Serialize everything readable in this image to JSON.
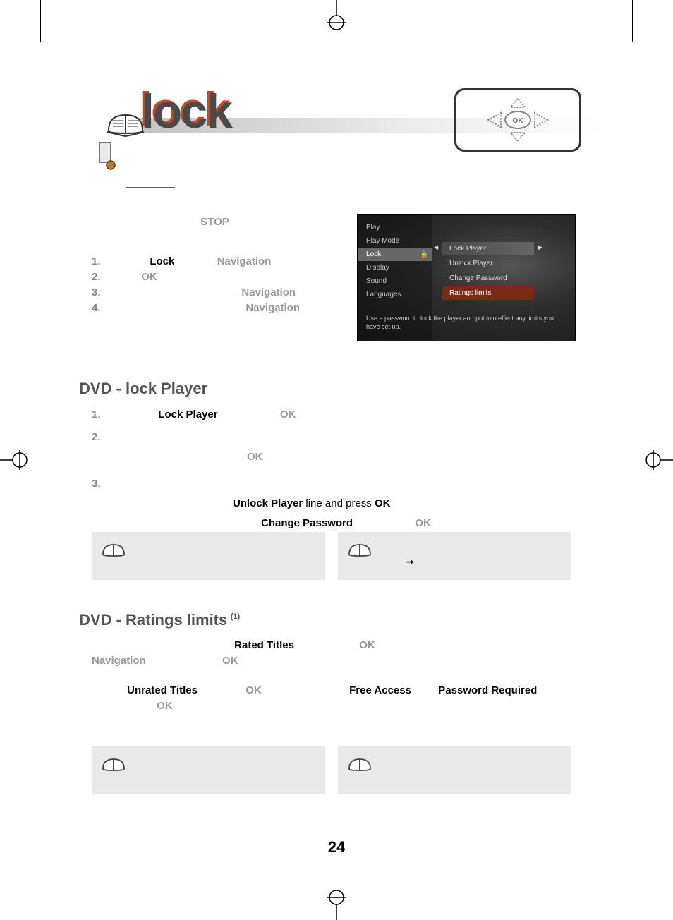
{
  "title": "lock",
  "header_band": {},
  "stop_label": "STOP",
  "steps_a": [
    {
      "num": "1.",
      "t1": "Lock",
      "t2": "Navigation"
    },
    {
      "num": "2.",
      "t1": "OK",
      "t2": ""
    },
    {
      "num": "3.",
      "t1": "",
      "t2": "Navigation"
    },
    {
      "num": "4.",
      "t1": "",
      "t2": "Navigation"
    }
  ],
  "osd": {
    "left_items": [
      "Play",
      "Play Mode",
      "Lock",
      "Display",
      "Sound",
      "Languages"
    ],
    "left_selected_index": 2,
    "right_items": [
      "Lock Player",
      "Unlock Player",
      "Change Password",
      "Ratings limits"
    ],
    "right_selected_index": 0,
    "right_highlight_index": 3,
    "help": "Use a password to lock the player and put into effect any limits you have set up."
  },
  "lock_section": {
    "heading": "DVD - lock Player",
    "steps": {
      "s1": {
        "num": "1.",
        "a": "Lock Player",
        "b": "OK"
      },
      "s2": {
        "num": "2.",
        "a": "OK"
      },
      "s3": {
        "num": "3.",
        "a": "Unlock Player",
        "b": "line and press",
        "c": "OK",
        "d": "Change Password",
        "e": "OK"
      }
    }
  },
  "note_arrow": "➞",
  "ratings_section": {
    "heading": "DVD - Ratings limits",
    "sup": "(1)",
    "labels": {
      "rated": "Rated Titles",
      "ok1": "OK",
      "nav": "Navigation",
      "ok2": "OK",
      "unrated": "Unrated Titles",
      "ok3": "OK",
      "free": "Free Access",
      "pwreq": "Password Required",
      "ok4": "OK"
    }
  },
  "page_number": "24"
}
